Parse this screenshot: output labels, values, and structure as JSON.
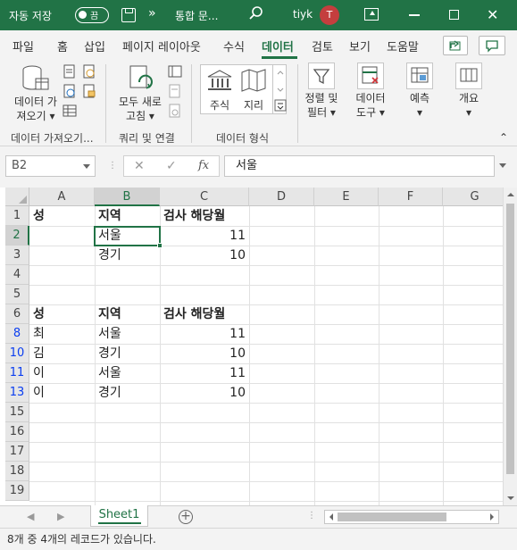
{
  "titlebar": {
    "autosave_label": "자동 저장",
    "autosave_state": "끔",
    "more": "»",
    "file_name": "통합 문...",
    "user_name": "tiyk",
    "avatar_initial": "T",
    "close": "✕",
    "accent_color": "#217346"
  },
  "tabs": [
    "파일",
    "홈",
    "삽입",
    "페이지 레이아웃",
    "수식",
    "데이터",
    "검토",
    "보기",
    "도움말"
  ],
  "active_tab": "데이터",
  "ribbon": {
    "get_data_label_1": "데이터 가",
    "get_data_label_2": "져오기 ▾",
    "group_get": "데이터 가져오기...",
    "refresh_label_1": "모두 새로",
    "refresh_label_2": "고침 ▾",
    "group_query": "쿼리 및 연결",
    "stocks_label": "주식",
    "geo_label": "지리",
    "group_datatype": "데이터 형식",
    "sort_label_1": "정렬 및",
    "sort_label_2": "필터 ▾",
    "tools_label_1": "데이터",
    "tools_label_2": "도구 ▾",
    "forecast_label_1": "예측",
    "forecast_label_2": "▾",
    "outline_label_1": "개요",
    "outline_label_2": "▾",
    "collapse": "⌃"
  },
  "formula_bar": {
    "name_box": "B2",
    "cancel": "✕",
    "enter": "✓",
    "fx": "fx",
    "content": "서울"
  },
  "columns": [
    "A",
    "B",
    "C",
    "D",
    "E",
    "F",
    "G"
  ],
  "rows": [
    "1",
    "2",
    "3",
    "4",
    "5",
    "6",
    "8",
    "10",
    "11",
    "13",
    "15",
    "16",
    "17",
    "18",
    "19"
  ],
  "cells": {
    "r1": {
      "a": "성",
      "b": "지역",
      "c": "검사 해당월"
    },
    "r2": {
      "a": "",
      "b": "서울",
      "c": "11"
    },
    "r3": {
      "a": "",
      "b": "경기",
      "c": "10"
    },
    "r6": {
      "a": "성",
      "b": "지역",
      "c": "검사 해당월"
    },
    "r8": {
      "a": "최",
      "b": "서울",
      "c": "11"
    },
    "r10": {
      "a": "김",
      "b": "경기",
      "c": "10"
    },
    "r11": {
      "a": "이",
      "b": "서울",
      "c": "11"
    },
    "r13": {
      "a": "이",
      "b": "경기",
      "c": "10"
    }
  },
  "sheets": {
    "active": "Sheet1",
    "add": "+",
    "nav_prev": "◀",
    "nav_next": "▶"
  },
  "status": "8개 중 4개의 레코드가 있습니다."
}
